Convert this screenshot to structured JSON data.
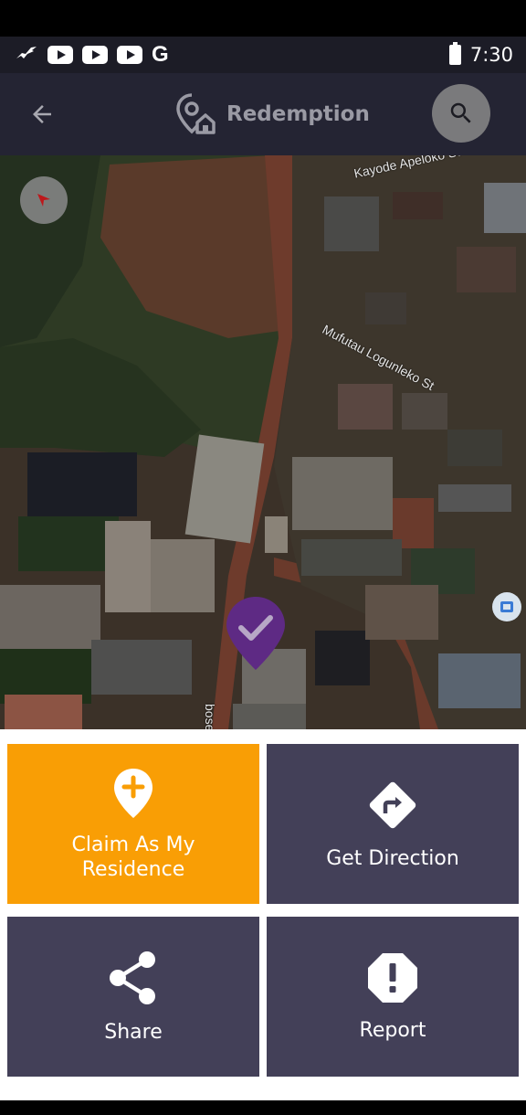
{
  "status_bar": {
    "time": "7:30",
    "g_label": "G",
    "icons": [
      "bird-icon",
      "youtube-icon",
      "youtube-icon",
      "youtube-icon",
      "google-icon",
      "battery-icon"
    ]
  },
  "app_bar": {
    "title": "Redemption",
    "icons": [
      "back-arrow-icon",
      "location-home-icon",
      "search-icon"
    ]
  },
  "map": {
    "streets": [
      "Kayode Apeloko St",
      "Mufutau Logunleko St",
      "bose St"
    ],
    "pin_color": "#5e2a84",
    "icons": [
      "compass-icon",
      "map-pin-check-icon",
      "layers-icon"
    ]
  },
  "actions": [
    {
      "label": "Claim As My Residence",
      "icon": "add-location-icon",
      "color": "#f99e05"
    },
    {
      "label": "Get Direction",
      "icon": "direction-turn-icon",
      "color": "#434058"
    },
    {
      "label": "Share",
      "icon": "share-icon",
      "color": "#434058"
    },
    {
      "label": "Report",
      "icon": "report-octagon-icon",
      "color": "#434058"
    }
  ]
}
